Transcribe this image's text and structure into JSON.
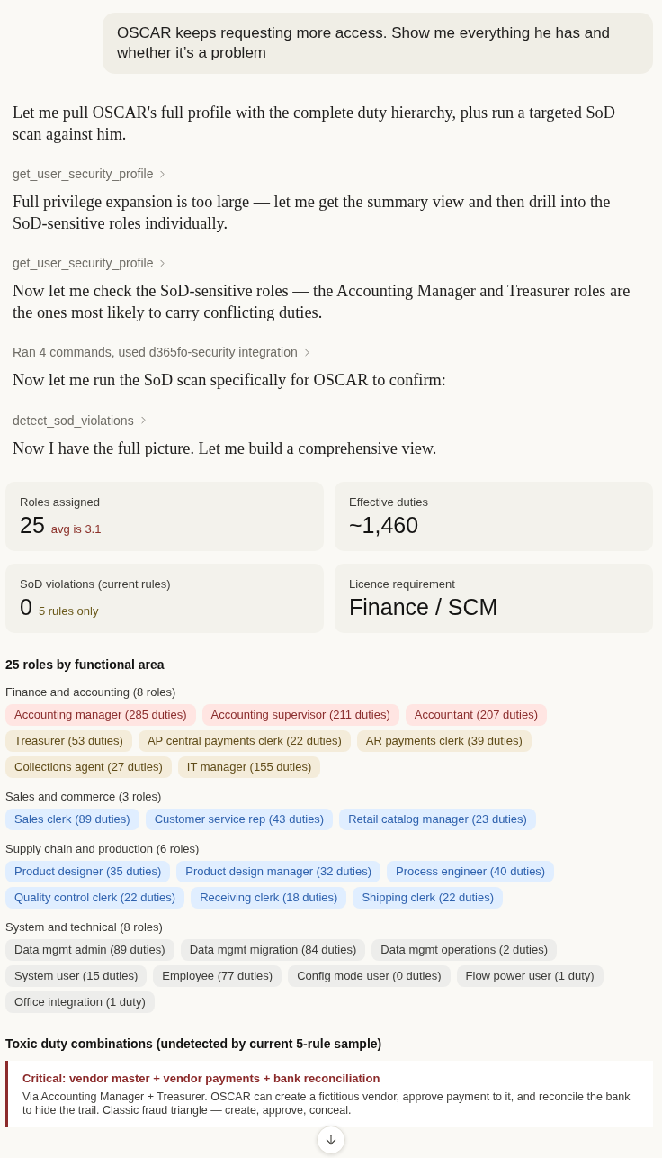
{
  "user_message": {
    "text": "OSCAR keeps requesting more access. Show me everything he has and whether it’s a problem"
  },
  "assistant_stream": [
    {
      "kind": "text",
      "text": "Let me pull OSCAR's full profile with the complete duty hierarchy, plus run a targeted SoD scan against him."
    },
    {
      "kind": "tool",
      "text": "get_user_security_profile"
    },
    {
      "kind": "text",
      "text": "Full privilege expansion is too large — let me get the summary view and then drill into the SoD-sensitive roles individually."
    },
    {
      "kind": "tool",
      "text": "get_user_security_profile"
    },
    {
      "kind": "text",
      "text": "Now let me check the SoD-sensitive roles — the Accounting Manager and Treasurer roles are the ones most likely to carry conflicting duties."
    },
    {
      "kind": "tool",
      "text": "Ran 4 commands, used d365fo-security integration"
    },
    {
      "kind": "text",
      "text": "Now let me run the SoD scan specifically for OSCAR to confirm:"
    },
    {
      "kind": "tool",
      "text": "detect_sod_violations"
    },
    {
      "kind": "text",
      "text": "Now I have the full picture. Let me build a comprehensive view."
    }
  ],
  "metrics": [
    {
      "label": "Roles assigned",
      "value": "25",
      "note": "avg is 3.1",
      "color": "#8b3029"
    },
    {
      "label": "Effective duties",
      "value": "~1,460"
    },
    {
      "label": "SoD violations (current rules)",
      "value": "0",
      "note": "5 rules only",
      "color": "#6b5a1c"
    },
    {
      "label": "Licence requirement",
      "value": "Finance / SCM"
    }
  ],
  "roles_section": {
    "title": "25 roles by functional area",
    "groups": [
      {
        "label": "Finance and accounting (8 roles)",
        "roles": [
          {
            "text": "Accounting manager (285 duties)",
            "color": "#8a2c2c"
          },
          {
            "text": "Accounting supervisor (211 duties)",
            "color": "#8a2c2c"
          },
          {
            "text": "Accountant (207 duties)",
            "color": "#8a2c2c"
          },
          {
            "text": "Treasurer (53 duties)",
            "color": "#5f4b18"
          },
          {
            "text": "AP central payments clerk (22 duties)",
            "color": "#5f4b18"
          },
          {
            "text": "AR payments clerk (39 duties)",
            "color": "#5f4b18"
          },
          {
            "text": "Collections agent (27 duties)",
            "color": "#5f4b18"
          },
          {
            "text": "IT manager (155 duties)",
            "color": "#5f4b18"
          }
        ]
      },
      {
        "label": "Sales and commerce (3 roles)",
        "roles": [
          {
            "text": "Sales clerk (89 duties)",
            "color": "#2f62ae"
          },
          {
            "text": "Customer service rep (43 duties)",
            "color": "#2f62ae"
          },
          {
            "text": "Retail catalog manager (23 duties)",
            "color": "#2f62ae"
          }
        ]
      },
      {
        "label": "Supply chain and production (6 roles)",
        "roles": [
          {
            "text": "Product designer (35 duties)",
            "color": "#2f62ae"
          },
          {
            "text": "Product design manager (32 duties)",
            "color": "#2f62ae"
          },
          {
            "text": "Process engineer (40 duties)",
            "color": "#2f62ae"
          },
          {
            "text": "Quality control clerk (22 duties)",
            "color": "#2f62ae"
          },
          {
            "text": "Receiving clerk (18 duties)",
            "color": "#2f62ae"
          },
          {
            "text": "Shipping clerk (22 duties)",
            "color": "#2f62ae"
          }
        ]
      },
      {
        "label": "System and technical (8 roles)",
        "roles": [
          {
            "text": "Data mgmt admin (89 duties)",
            "color": "#3b3b38"
          },
          {
            "text": "Data mgmt migration (84 duties)",
            "color": "#3b3b38"
          },
          {
            "text": "Data mgmt operations (2 duties)",
            "color": "#3b3b38"
          },
          {
            "text": "System user (15 duties)",
            "color": "#3b3b38"
          },
          {
            "text": "Employee (77 duties)",
            "color": "#3b3b38"
          },
          {
            "text": "Config mode user (0 duties)",
            "color": "#3b3b38"
          },
          {
            "text": "Flow power user (1 duty)",
            "color": "#3b3b38"
          },
          {
            "text": "Office integration (1 duty)",
            "color": "#3b3b38"
          }
        ]
      }
    ]
  },
  "toxic_section": {
    "title": "Toxic duty combinations (undetected by current 5-rule sample)",
    "items": [
      {
        "color": "#8b2a2a",
        "title": "Critical: vendor master + vendor payments + bank reconciliation",
        "text": "Via Accounting Manager + Treasurer. OSCAR can create a fictitious vendor, approve payment to it, and reconcile the bank to hide the trail. Classic fraud triangle — create, approve, conceal."
      }
    ]
  }
}
